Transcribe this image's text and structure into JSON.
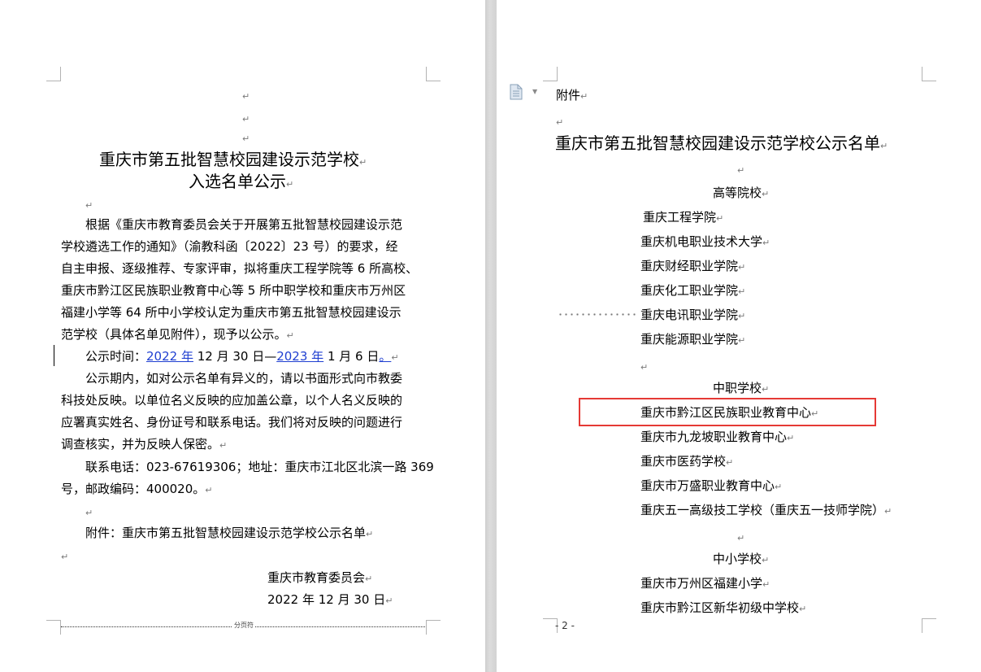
{
  "page1": {
    "title_line1": "重庆市第五批智慧校园建设示范学校",
    "title_line2": "入选名单公示",
    "para1_lines": [
      "根据《重庆市教育委员会关于开展第五批智慧校园建设示范",
      "学校遴选工作的通知》（渝教科函〔2022〕23 号）的要求，经",
      "自主申报、逐级推荐、专家评审，拟将重庆工程学院等 6 所高校、",
      "重庆市黔江区民族职业教育中心等 5 所中职学校和重庆市万州区",
      "福建小学等 64 所中小学校认定为重庆市第五批智慧校园建设示",
      "范学校（具体名单见附件），现予以公示。"
    ],
    "time_label": "公示时间：",
    "time_year1": "2022 年",
    "time_mid": " 12 月 30 日—",
    "time_year2": "2023 年",
    "time_end": " 1 月 6 日",
    "time_period": "。",
    "para3_lines": [
      "公示期内，如对公示名单有异义的，请以书面形式向市教委",
      "科技处反映。以单位名义反映的应加盖公章，以个人名义反映的",
      "应署真实姓名、身份证号和联系电话。我们将对反映的问题进行",
      "调查核实，并为反映人保密。"
    ],
    "contact_line1": "联系电话：023-67619306；地址：重庆市江北区北滨一路 369",
    "contact_line2": "号，邮政编码：400020。",
    "attachment": "附件：重庆市第五批智慧校园建设示范学校公示名单",
    "signer": "重庆市教育委员会",
    "date": "2022 年 12 月 30 日",
    "page_break_label": "分页符"
  },
  "page2": {
    "attachment_label": "附件",
    "title": "重庆市第五批智慧校园建设示范学校公示名单",
    "section_higher": "高等院校",
    "higher_schools": [
      "重庆工程学院",
      "重庆机电职业技术大学",
      "重庆财经职业学院",
      "重庆化工职业学院",
      "重庆电讯职业学院",
      "重庆能源职业学院"
    ],
    "section_vocational": "中职学校",
    "vocational_schools": [
      "重庆市黔江区民族职业教育中心",
      "重庆市九龙坡职业教育中心",
      "重庆市医药学校",
      "重庆市万盛职业教育中心",
      "重庆五一高级技工学校（重庆五一技师学院）"
    ],
    "section_k12": "中小学校",
    "k12_schools": [
      "重庆市万州区福建小学",
      "重庆市黔江区新华初级中学校"
    ],
    "footer_page": "- 2 -"
  },
  "marks": {
    "paragraph": "↵"
  },
  "colors": {
    "highlight": "#e53935",
    "link": "#1f3fd1"
  }
}
